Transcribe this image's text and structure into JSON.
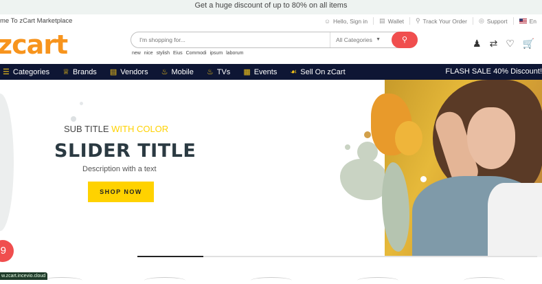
{
  "promo_bar": {
    "text": "Get a huge discount of up to 80% on all items"
  },
  "info_bar": {
    "welcome": "me To zCart Marketplace",
    "links": [
      {
        "icon": "user-icon",
        "label": "Hello, Sign in"
      },
      {
        "icon": "wallet-icon",
        "label": "Wallet"
      },
      {
        "icon": "location-icon",
        "label": "Track Your Order"
      },
      {
        "icon": "support-icon",
        "label": "Support"
      },
      {
        "icon": "flag-icon",
        "label": "En"
      }
    ]
  },
  "header": {
    "logo": "zcart",
    "search": {
      "placeholder": "I'm shopping for...",
      "category": "All Categories"
    },
    "tags": [
      "new",
      "nice",
      "stylish",
      "Eius",
      "Commodi",
      "ipsum",
      "laborum"
    ]
  },
  "nav": {
    "items": [
      {
        "icon": "menu-icon",
        "label": "Categories"
      },
      {
        "icon": "crown-icon",
        "label": "Brands"
      },
      {
        "icon": "store-icon",
        "label": "Vendors"
      },
      {
        "icon": "fire-icon",
        "label": "Mobile"
      },
      {
        "icon": "fire-icon",
        "label": "TVs"
      },
      {
        "icon": "calendar-icon",
        "label": "Events"
      },
      {
        "icon": "sell-icon",
        "label": "Sell On zCart"
      }
    ],
    "flash": "FLASH SALE 40% Discount!"
  },
  "hero": {
    "subtitle_plain": "SUB TITLE ",
    "subtitle_highlight": "WITH COLOR",
    "title": "SLIDER TITLE",
    "description": "Description with a text",
    "cta": "SHOP NOW",
    "slider_progress": 0.165
  },
  "badge": {
    "count": "9"
  },
  "status_url": "w.zcart.incevio.cloud",
  "colors": {
    "accent": "#f7941d",
    "highlight": "#ffd200",
    "nav_bg": "#0e1634",
    "search_button": "#f04e4e"
  }
}
